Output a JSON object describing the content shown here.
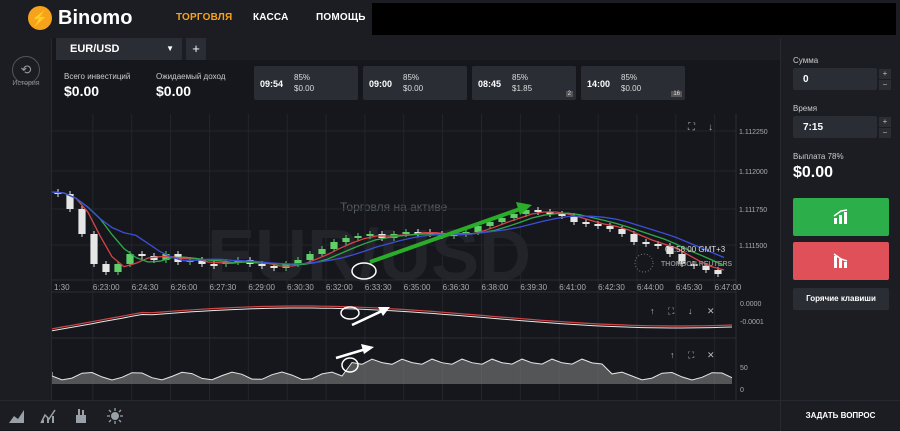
{
  "header": {
    "brand": "Binomo",
    "nav": [
      {
        "label": "ТОРГОВЛЯ",
        "active": true
      },
      {
        "label": "КАССА",
        "active": false
      },
      {
        "label": "ПОМОЩЬ",
        "active": false
      }
    ]
  },
  "sidebar": {
    "history_label": "История"
  },
  "tabs": {
    "asset": "EUR/USD",
    "add": "+"
  },
  "stats": {
    "total_invest_label": "Всего инвестиций",
    "total_invest_value": "$0.00",
    "expected_income_label": "Ожидаемый доход",
    "expected_income_value": "$0.00"
  },
  "deals": [
    {
      "time": "09:54",
      "pct": "85%",
      "value": "$0.00",
      "badge": ""
    },
    {
      "time": "09:00",
      "pct": "85%",
      "value": "$0.00",
      "badge": ""
    },
    {
      "time": "08:45",
      "pct": "85%",
      "value": "$1.85",
      "badge": "2"
    },
    {
      "time": "14:00",
      "pct": "85%",
      "value": "$0.00",
      "badge": "16"
    }
  ],
  "chart": {
    "watermark": "EUR/USD",
    "notice": "Торговля на активе",
    "clock": "06:58:00 GMT+3",
    "provider": "THOMSON REUTERS",
    "price_ticks": [
      "1.112250",
      "1.112000",
      "1.111750",
      "1.111500"
    ],
    "time_ticks": [
      "1:30",
      "6:23:00",
      "6:24:30",
      "6:26:00",
      "6:27:30",
      "6:29:00",
      "6:30:30",
      "6:32:00",
      "6:33:30",
      "6:35:00",
      "6:36:30",
      "6:38:00",
      "6:39:30",
      "6:41:00",
      "6:42:30",
      "6:44:00",
      "6:45:30",
      "6:47:00"
    ],
    "macd_ticks": [
      "0.0000",
      "-0.0001"
    ],
    "osc_ticks": [
      "50",
      "0"
    ]
  },
  "panel": {
    "amount_label": "Сумма",
    "amount_value": "0",
    "time_label": "Время",
    "time_value": "7:15",
    "payout_label": "Выплата 78%",
    "payout_value": "$0.00",
    "hotkeys": "Горячие клавиши"
  },
  "footer": {
    "ask_label": "ЗАДАТЬ ВОПРОС"
  },
  "colors": {
    "accent": "#f7a21b",
    "up": "#2cae4a",
    "down": "#e05058"
  }
}
